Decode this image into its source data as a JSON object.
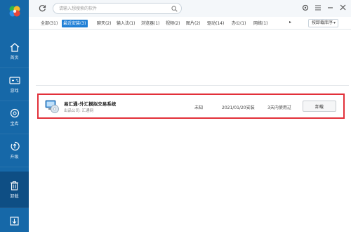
{
  "search": {
    "placeholder": "请输入想搜索的软件"
  },
  "sidebar": {
    "items": [
      {
        "label": "首页",
        "icon": "home-icon"
      },
      {
        "label": "游戏",
        "icon": "gamepad-icon"
      },
      {
        "label": "宝库",
        "icon": "treasure-icon"
      },
      {
        "label": "升级",
        "icon": "upgrade-icon"
      },
      {
        "label": "卸载",
        "icon": "trash-icon",
        "active": true
      },
      {
        "label": "",
        "icon": "download-icon"
      }
    ]
  },
  "tabs": [
    {
      "label": "全部(31)"
    },
    {
      "label": "最近安装(3)",
      "active": true
    },
    {
      "label": "聊天(2)"
    },
    {
      "label": "输入法(1)"
    },
    {
      "label": "浏览器(1)"
    },
    {
      "label": "视频(2)"
    },
    {
      "label": "图片(2)"
    },
    {
      "label": "驱动(14)"
    },
    {
      "label": "办公(1)"
    },
    {
      "label": "网络(1)"
    }
  ],
  "sort": {
    "selected": "按卸载库序"
  },
  "app": {
    "name": "易汇通-外汇模拟交易系统",
    "publisher": "出品公司: 汇通网",
    "size": "未知",
    "install_date": "2021/01/20安装",
    "usage": "3天内使用过",
    "uninstall_label": "卸载"
  },
  "colors": {
    "sidebar": "#1668a8",
    "sidebar_active": "#0e4e84",
    "accent": "#1f7fd6",
    "highlight": "#e2303a"
  }
}
